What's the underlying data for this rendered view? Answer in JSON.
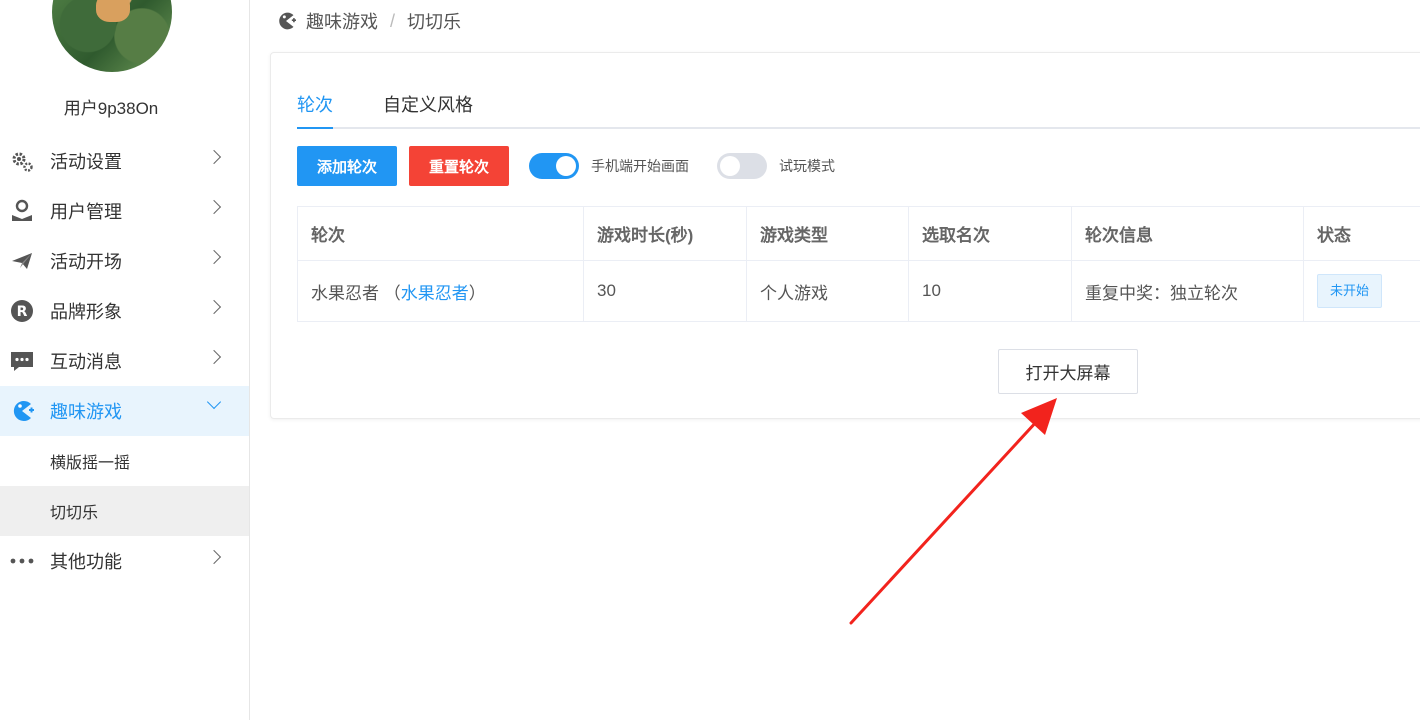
{
  "sidebar": {
    "username": "用户9p38On",
    "items": [
      {
        "label": "活动设置",
        "icon": "gears-icon"
      },
      {
        "label": "用户管理",
        "icon": "user-icon"
      },
      {
        "label": "活动开场",
        "icon": "paper-plane-icon"
      },
      {
        "label": "品牌形象",
        "icon": "registered-icon"
      },
      {
        "label": "互动消息",
        "icon": "chat-icon"
      },
      {
        "label": "趣味游戏",
        "icon": "game-icon",
        "active": true
      },
      {
        "label": "其他功能",
        "icon": "more-icon"
      }
    ],
    "sub_items": [
      {
        "label": "横版摇一摇"
      },
      {
        "label": "切切乐",
        "selected": true
      }
    ]
  },
  "breadcrumb": {
    "parent": "趣味游戏",
    "separator": "/",
    "current": "切切乐"
  },
  "tabs": [
    {
      "label": "轮次",
      "active": true
    },
    {
      "label": "自定义风格",
      "active": false
    }
  ],
  "toolbar": {
    "add_label": "添加轮次",
    "reset_label": "重置轮次",
    "mobile_start_label": "手机端开始画面",
    "mobile_start_on": true,
    "trial_mode_label": "试玩模式",
    "trial_mode_on": false
  },
  "table": {
    "headers": [
      "轮次",
      "游戏时长(秒)",
      "游戏类型",
      "选取名次",
      "轮次信息",
      "状态"
    ],
    "rows": [
      {
        "round": "水果忍者",
        "round_link_prefix": "（",
        "round_link": "水果忍者",
        "round_link_suffix": "）",
        "duration": "30",
        "type": "个人游戏",
        "rank": "10",
        "info": "重复中奖：独立轮次",
        "status": "未开始"
      }
    ]
  },
  "open_screen_label": "打开大屏幕",
  "colors": {
    "primary": "#2196f3",
    "danger": "#f44336",
    "annotation_arrow": "#f2231d"
  }
}
